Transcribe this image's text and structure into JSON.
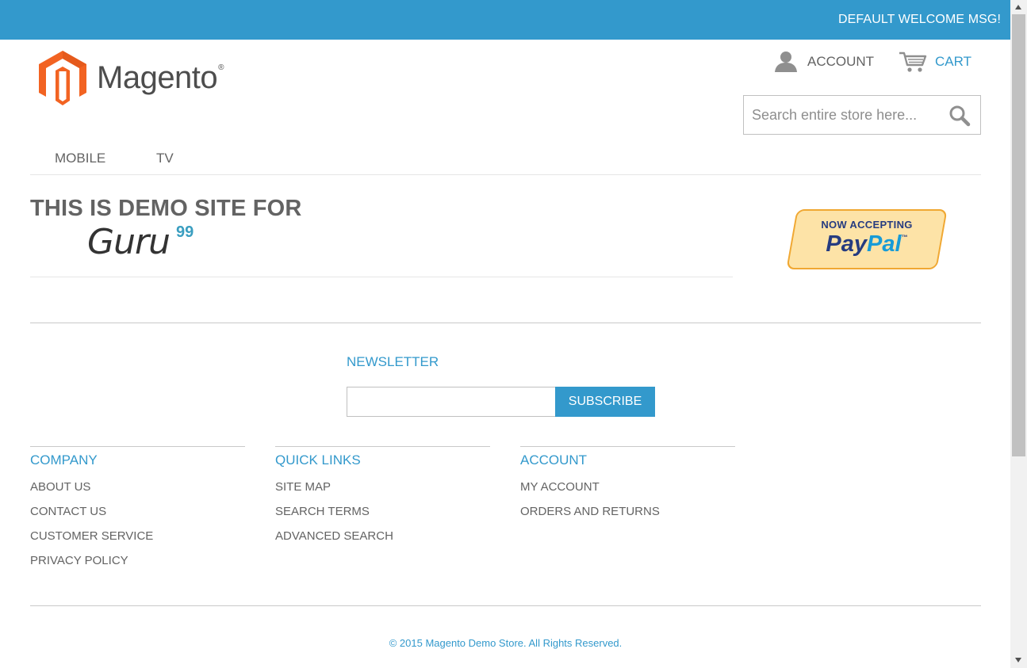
{
  "topbar": {
    "welcome": "DEFAULT WELCOME MSG!"
  },
  "logo": {
    "name": "Magento",
    "reg": "®"
  },
  "header_links": {
    "account": "ACCOUNT",
    "cart": "CART"
  },
  "search": {
    "placeholder": "Search entire store here..."
  },
  "nav": {
    "items": [
      {
        "label": "MOBILE"
      },
      {
        "label": "TV"
      }
    ]
  },
  "promo": {
    "title": "THIS IS DEMO SITE FOR",
    "guru_word": "Guru",
    "guru_sup": "99",
    "paypal_line1": "NOW ACCEPTING",
    "paypal_pay": "Pay",
    "paypal_pal": "Pal",
    "paypal_tm": "™"
  },
  "newsletter": {
    "title": "NEWSLETTER",
    "input_value": "",
    "button": "SUBSCRIBE"
  },
  "footer": {
    "columns": [
      {
        "title": "COMPANY",
        "links": [
          "ABOUT US",
          "CONTACT US",
          "CUSTOMER SERVICE",
          "PRIVACY POLICY"
        ]
      },
      {
        "title": "QUICK LINKS",
        "links": [
          "SITE MAP",
          "SEARCH TERMS",
          "ADVANCED SEARCH"
        ]
      },
      {
        "title": "ACCOUNT",
        "links": [
          "MY ACCOUNT",
          "ORDERS AND RETURNS"
        ]
      }
    ],
    "copyright": "© 2015 Magento Demo Store. All Rights Reserved."
  },
  "colors": {
    "accent": "#3399cc",
    "text": "#636363",
    "logo_orange": "#f26322"
  },
  "icons": {
    "account": "user-icon",
    "cart": "cart-icon",
    "search": "search-icon"
  }
}
